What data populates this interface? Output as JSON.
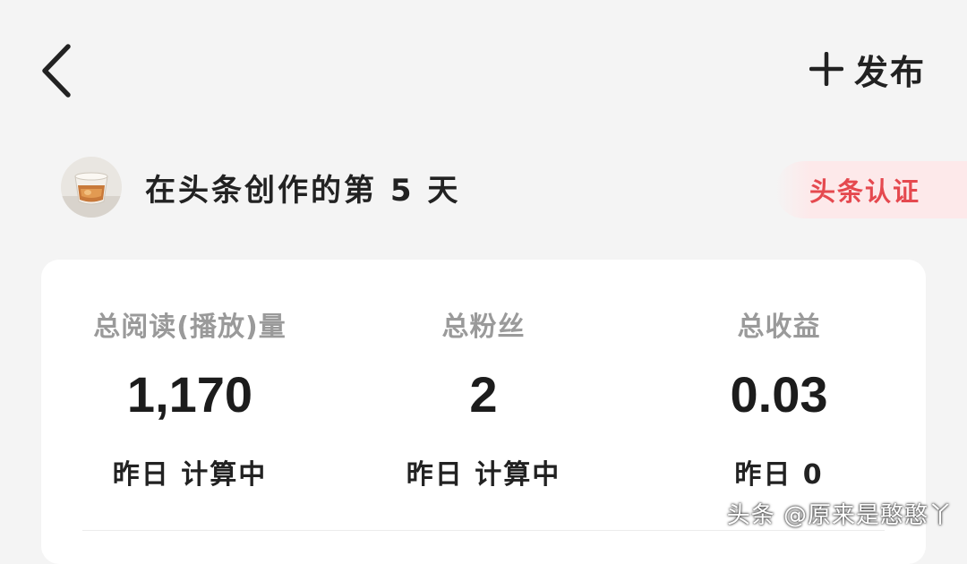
{
  "header": {
    "back_icon": "chevron-left-icon",
    "publish_icon": "plus-icon",
    "publish_label": "发布"
  },
  "profile": {
    "avatar_icon": "avatar-drink-image",
    "creator_days_text": "在头条创作的第 5 天",
    "certification_label": "头条认证",
    "certification_color": "#e5494f"
  },
  "stats": [
    {
      "label": "总阅读(播放)量",
      "value": "1,170",
      "sub": "昨日 计算中"
    },
    {
      "label": "总粉丝",
      "value": "2",
      "sub": "昨日 计算中"
    },
    {
      "label": "总收益",
      "value": "0.03",
      "sub": "昨日 0"
    }
  ],
  "watermark": "头条 @原来是憨憨丫"
}
